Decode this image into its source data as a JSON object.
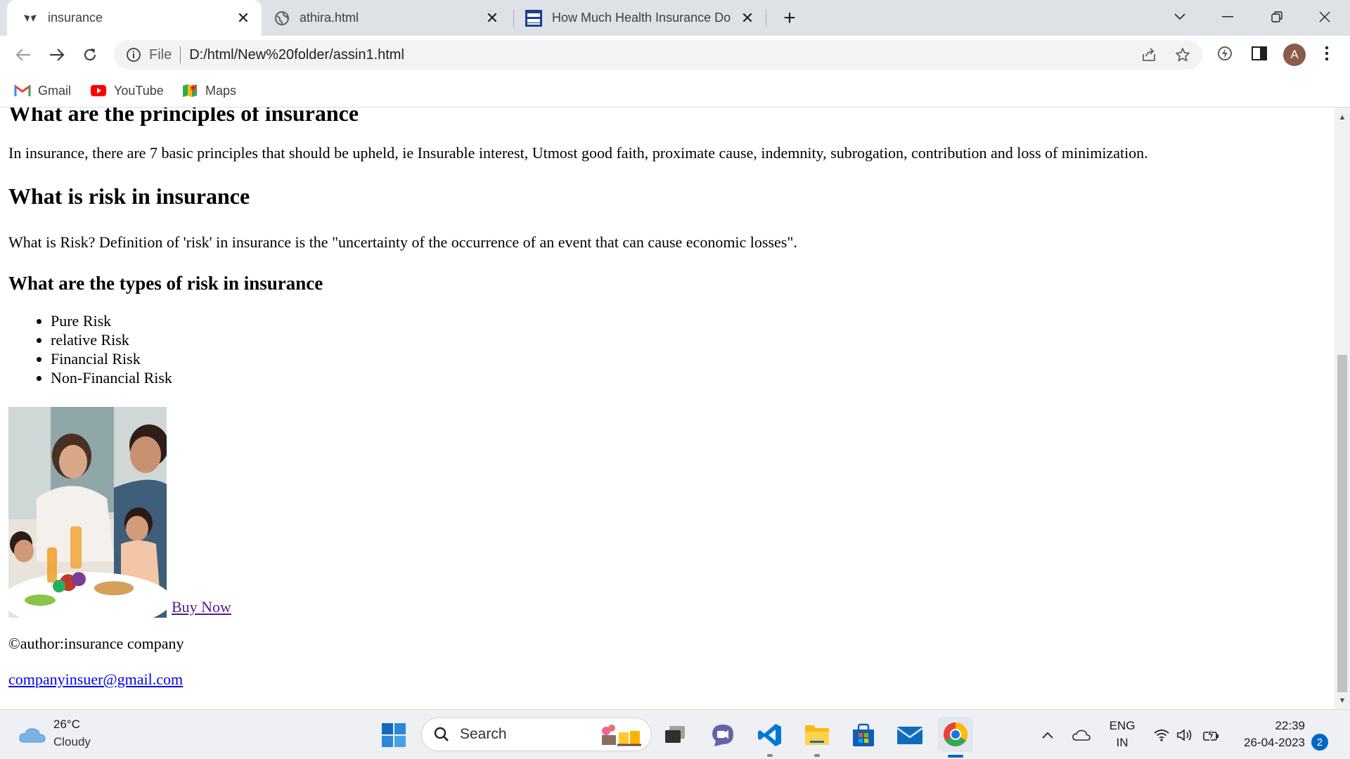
{
  "browser": {
    "tabs": [
      {
        "title": "insurance",
        "icon": "insurance-logo-icon",
        "active": true
      },
      {
        "title": "athira.html",
        "icon": "globe-icon",
        "active": false
      },
      {
        "title": "How Much Health Insurance Do",
        "icon": "tata-aig-icon",
        "active": false
      }
    ],
    "new_tab_label": "+",
    "omnibox": {
      "scheme_label": "File",
      "url": "D:/html/New%20folder/assin1.html"
    },
    "profile_initial": "A",
    "bookmarks": [
      {
        "label": "Gmail",
        "icon": "gmail-icon"
      },
      {
        "label": "YouTube",
        "icon": "youtube-icon"
      },
      {
        "label": "Maps",
        "icon": "maps-icon"
      }
    ]
  },
  "page": {
    "heading_principles": "What are the principles of insurance",
    "principles_text": "In insurance, there are 7 basic principles that should be upheld, ie Insurable interest, Utmost good faith, proximate cause, indemnity, subrogation, contribution and loss of minimization.",
    "heading_risk": "What is risk in insurance",
    "risk_text": "What is Risk? Definition of 'risk' in insurance is the \"uncertainty of the occurrence of an event that can cause economic losses\".",
    "heading_types": "What are the types of risk in insurance",
    "risk_types": [
      "Pure Risk",
      "relative Risk",
      "Financial Risk",
      "Non-Financial Risk"
    ],
    "buy_link": "Buy Now",
    "author": "©author:insurance company",
    "email": "companyinsuer@gmail.com"
  },
  "taskbar": {
    "weather_temp": "26°C",
    "weather_desc": "Cloudy",
    "search_label": "Search",
    "language_top": "ENG",
    "language_bottom": "IN",
    "time": "22:39",
    "date": "26-04-2023",
    "notification_count": "2"
  },
  "colors": {
    "tabstrip": "#dee1e6",
    "link_visited": "#551a8b",
    "link": "#0000ee",
    "accent": "#0067c0"
  }
}
